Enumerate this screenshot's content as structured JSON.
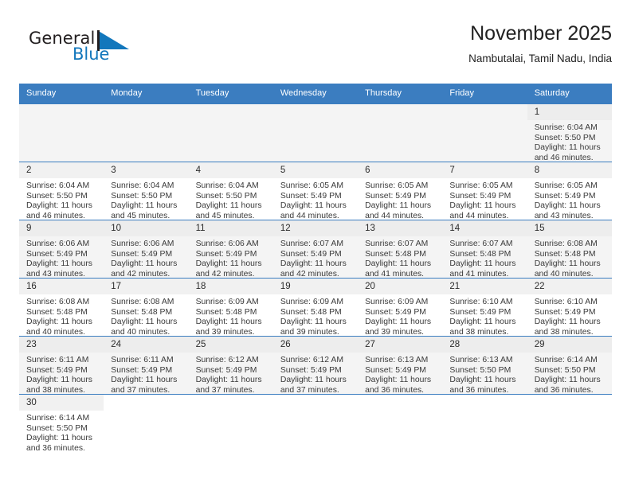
{
  "brand": {
    "name_part1": "General",
    "name_part2": "Blue",
    "flag_icon": "blue-flag-triangle",
    "color_primary": "#1277bc",
    "color_text": "#231f20"
  },
  "header": {
    "title": "November 2025",
    "subtitle": "Nambutalai, Tamil Nadu, India"
  },
  "theme": {
    "header_bg": "#3b7dc0",
    "header_text": "#ffffff",
    "row_alt_bg": "#f4f4f4",
    "row_bg": "#ffffff",
    "daynum_bg": "#eeeeee",
    "grid_line": "#3b7dc0"
  },
  "calendar": {
    "weekday_headers": [
      "Sunday",
      "Monday",
      "Tuesday",
      "Wednesday",
      "Thursday",
      "Friday",
      "Saturday"
    ],
    "labels": {
      "sunrise": "Sunrise:",
      "sunset": "Sunset:",
      "daylight": "Daylight:"
    },
    "weeks": [
      {
        "alt": true,
        "days": [
          null,
          null,
          null,
          null,
          null,
          null,
          {
            "day": "1",
            "sunrise": "Sunrise: 6:04 AM",
            "sunset": "Sunset: 5:50 PM",
            "daylight_line1": "Daylight: 11 hours",
            "daylight_line2": "and 46 minutes."
          }
        ]
      },
      {
        "alt": false,
        "days": [
          {
            "day": "2",
            "sunrise": "Sunrise: 6:04 AM",
            "sunset": "Sunset: 5:50 PM",
            "daylight_line1": "Daylight: 11 hours",
            "daylight_line2": "and 46 minutes."
          },
          {
            "day": "3",
            "sunrise": "Sunrise: 6:04 AM",
            "sunset": "Sunset: 5:50 PM",
            "daylight_line1": "Daylight: 11 hours",
            "daylight_line2": "and 45 minutes."
          },
          {
            "day": "4",
            "sunrise": "Sunrise: 6:04 AM",
            "sunset": "Sunset: 5:50 PM",
            "daylight_line1": "Daylight: 11 hours",
            "daylight_line2": "and 45 minutes."
          },
          {
            "day": "5",
            "sunrise": "Sunrise: 6:05 AM",
            "sunset": "Sunset: 5:49 PM",
            "daylight_line1": "Daylight: 11 hours",
            "daylight_line2": "and 44 minutes."
          },
          {
            "day": "6",
            "sunrise": "Sunrise: 6:05 AM",
            "sunset": "Sunset: 5:49 PM",
            "daylight_line1": "Daylight: 11 hours",
            "daylight_line2": "and 44 minutes."
          },
          {
            "day": "7",
            "sunrise": "Sunrise: 6:05 AM",
            "sunset": "Sunset: 5:49 PM",
            "daylight_line1": "Daylight: 11 hours",
            "daylight_line2": "and 44 minutes."
          },
          {
            "day": "8",
            "sunrise": "Sunrise: 6:05 AM",
            "sunset": "Sunset: 5:49 PM",
            "daylight_line1": "Daylight: 11 hours",
            "daylight_line2": "and 43 minutes."
          }
        ]
      },
      {
        "alt": true,
        "days": [
          {
            "day": "9",
            "sunrise": "Sunrise: 6:06 AM",
            "sunset": "Sunset: 5:49 PM",
            "daylight_line1": "Daylight: 11 hours",
            "daylight_line2": "and 43 minutes."
          },
          {
            "day": "10",
            "sunrise": "Sunrise: 6:06 AM",
            "sunset": "Sunset: 5:49 PM",
            "daylight_line1": "Daylight: 11 hours",
            "daylight_line2": "and 42 minutes."
          },
          {
            "day": "11",
            "sunrise": "Sunrise: 6:06 AM",
            "sunset": "Sunset: 5:49 PM",
            "daylight_line1": "Daylight: 11 hours",
            "daylight_line2": "and 42 minutes."
          },
          {
            "day": "12",
            "sunrise": "Sunrise: 6:07 AM",
            "sunset": "Sunset: 5:49 PM",
            "daylight_line1": "Daylight: 11 hours",
            "daylight_line2": "and 42 minutes."
          },
          {
            "day": "13",
            "sunrise": "Sunrise: 6:07 AM",
            "sunset": "Sunset: 5:48 PM",
            "daylight_line1": "Daylight: 11 hours",
            "daylight_line2": "and 41 minutes."
          },
          {
            "day": "14",
            "sunrise": "Sunrise: 6:07 AM",
            "sunset": "Sunset: 5:48 PM",
            "daylight_line1": "Daylight: 11 hours",
            "daylight_line2": "and 41 minutes."
          },
          {
            "day": "15",
            "sunrise": "Sunrise: 6:08 AM",
            "sunset": "Sunset: 5:48 PM",
            "daylight_line1": "Daylight: 11 hours",
            "daylight_line2": "and 40 minutes."
          }
        ]
      },
      {
        "alt": false,
        "days": [
          {
            "day": "16",
            "sunrise": "Sunrise: 6:08 AM",
            "sunset": "Sunset: 5:48 PM",
            "daylight_line1": "Daylight: 11 hours",
            "daylight_line2": "and 40 minutes."
          },
          {
            "day": "17",
            "sunrise": "Sunrise: 6:08 AM",
            "sunset": "Sunset: 5:48 PM",
            "daylight_line1": "Daylight: 11 hours",
            "daylight_line2": "and 40 minutes."
          },
          {
            "day": "18",
            "sunrise": "Sunrise: 6:09 AM",
            "sunset": "Sunset: 5:48 PM",
            "daylight_line1": "Daylight: 11 hours",
            "daylight_line2": "and 39 minutes."
          },
          {
            "day": "19",
            "sunrise": "Sunrise: 6:09 AM",
            "sunset": "Sunset: 5:48 PM",
            "daylight_line1": "Daylight: 11 hours",
            "daylight_line2": "and 39 minutes."
          },
          {
            "day": "20",
            "sunrise": "Sunrise: 6:09 AM",
            "sunset": "Sunset: 5:49 PM",
            "daylight_line1": "Daylight: 11 hours",
            "daylight_line2": "and 39 minutes."
          },
          {
            "day": "21",
            "sunrise": "Sunrise: 6:10 AM",
            "sunset": "Sunset: 5:49 PM",
            "daylight_line1": "Daylight: 11 hours",
            "daylight_line2": "and 38 minutes."
          },
          {
            "day": "22",
            "sunrise": "Sunrise: 6:10 AM",
            "sunset": "Sunset: 5:49 PM",
            "daylight_line1": "Daylight: 11 hours",
            "daylight_line2": "and 38 minutes."
          }
        ]
      },
      {
        "alt": true,
        "days": [
          {
            "day": "23",
            "sunrise": "Sunrise: 6:11 AM",
            "sunset": "Sunset: 5:49 PM",
            "daylight_line1": "Daylight: 11 hours",
            "daylight_line2": "and 38 minutes."
          },
          {
            "day": "24",
            "sunrise": "Sunrise: 6:11 AM",
            "sunset": "Sunset: 5:49 PM",
            "daylight_line1": "Daylight: 11 hours",
            "daylight_line2": "and 37 minutes."
          },
          {
            "day": "25",
            "sunrise": "Sunrise: 6:12 AM",
            "sunset": "Sunset: 5:49 PM",
            "daylight_line1": "Daylight: 11 hours",
            "daylight_line2": "and 37 minutes."
          },
          {
            "day": "26",
            "sunrise": "Sunrise: 6:12 AM",
            "sunset": "Sunset: 5:49 PM",
            "daylight_line1": "Daylight: 11 hours",
            "daylight_line2": "and 37 minutes."
          },
          {
            "day": "27",
            "sunrise": "Sunrise: 6:13 AM",
            "sunset": "Sunset: 5:49 PM",
            "daylight_line1": "Daylight: 11 hours",
            "daylight_line2": "and 36 minutes."
          },
          {
            "day": "28",
            "sunrise": "Sunrise: 6:13 AM",
            "sunset": "Sunset: 5:50 PM",
            "daylight_line1": "Daylight: 11 hours",
            "daylight_line2": "and 36 minutes."
          },
          {
            "day": "29",
            "sunrise": "Sunrise: 6:14 AM",
            "sunset": "Sunset: 5:50 PM",
            "daylight_line1": "Daylight: 11 hours",
            "daylight_line2": "and 36 minutes."
          }
        ]
      },
      {
        "alt": false,
        "days": [
          {
            "day": "30",
            "sunrise": "Sunrise: 6:14 AM",
            "sunset": "Sunset: 5:50 PM",
            "daylight_line1": "Daylight: 11 hours",
            "daylight_line2": "and 36 minutes."
          },
          null,
          null,
          null,
          null,
          null,
          null
        ]
      }
    ]
  }
}
